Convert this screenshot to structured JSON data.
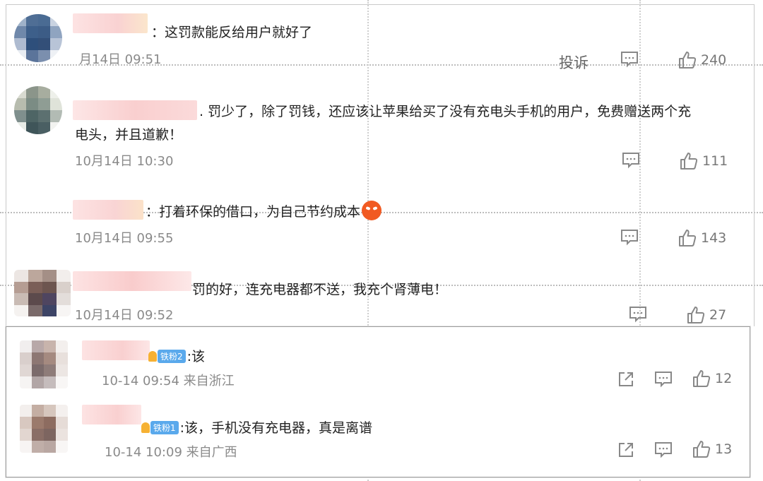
{
  "comments": [
    {
      "text": "：这罚款能反给用户就好了",
      "time": "月14日 09:51",
      "report_label": "投诉",
      "like_count": "240"
    },
    {
      "text": ". 罚少了，除了罚钱，还应该让苹果给买了没有充电头手机的用户，免费赠送两个充",
      "text_line2": "电头，并且道歉！",
      "time": "10月14日 10:30",
      "like_count": "111"
    },
    {
      "text": "：打着环保的借口，为自己节约成本",
      "time": "10月14日 09:55",
      "like_count": "143"
    },
    {
      "text": "罚的好，连充电器都不送，我充个肾薄电！",
      "time": "10月14日 09:52",
      "like_count": "27"
    }
  ],
  "replies": [
    {
      "badge": "铁粉2",
      "text": ":该",
      "time": "10-14 09:54 来自浙江",
      "like_count": "12"
    },
    {
      "badge": "铁粉1",
      "text": ":该，手机没有充电器，真是离谱",
      "time": "10-14 10:09 来自广西",
      "like_count": "13"
    }
  ],
  "icons": {
    "comment": "comment-icon",
    "like": "thumbs-up-icon",
    "share": "share-icon",
    "emoji": "angry-face-emoji"
  },
  "colors": {
    "badge": "#5aa9ec",
    "text": "#222222",
    "meta": "#8a8a8a"
  }
}
